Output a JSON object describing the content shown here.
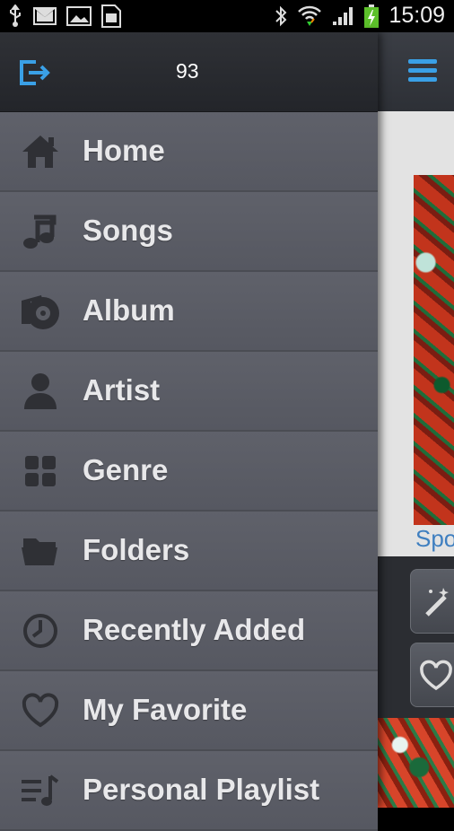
{
  "status_bar": {
    "icons": [
      "usb-icon",
      "gmail-icon",
      "gallery-icon",
      "sim-icon",
      "bluetooth-icon",
      "wifi-icon",
      "signal-icon",
      "battery-charging-icon"
    ],
    "time": "15:09"
  },
  "drawer": {
    "count": "93",
    "header_icon": "exit-icon",
    "items": [
      {
        "label": "Home",
        "icon": "home-icon"
      },
      {
        "label": "Songs",
        "icon": "music-note-icon"
      },
      {
        "label": "Album",
        "icon": "album-icon"
      },
      {
        "label": "Artist",
        "icon": "person-icon"
      },
      {
        "label": "Genre",
        "icon": "grid-icon"
      },
      {
        "label": "Folders",
        "icon": "folder-icon"
      },
      {
        "label": "Recently Added",
        "icon": "clock-icon"
      },
      {
        "label": "My Favorite",
        "icon": "heart-icon"
      },
      {
        "label": "Personal Playlist",
        "icon": "playlist-icon"
      }
    ]
  },
  "background_screen": {
    "caption": "Spo",
    "menu_icon": "menu-icon",
    "actions": [
      "magic-wand-icon",
      "heart-icon"
    ]
  },
  "colors": {
    "accent": "#3aa0e6",
    "drawer_bg": "#55575f",
    "header_bg": "#2a2c31"
  }
}
